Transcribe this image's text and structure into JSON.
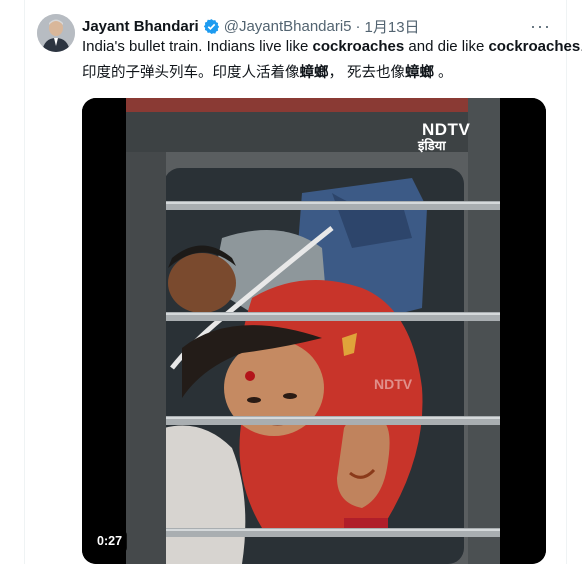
{
  "tweet": {
    "author_name": "Jayant Bhandari",
    "handle": "@JayantBhandari5",
    "separator": "·",
    "date": "1月13日",
    "more_label": "···",
    "text_en": {
      "part1": "India's bullet train. Indians live like ",
      "bold1": "cockroaches",
      "part2": " and die like ",
      "bold2": "cockroaches",
      "part3": "."
    },
    "text_zh": {
      "part1": "印度的子弹头列车。印度人活着像",
      "bold1": "蟑螂",
      "part2": "，  死去也像",
      "bold2": "蟑螂",
      "part3": " 。"
    }
  },
  "video": {
    "duration": "0:27",
    "watermark_top": "NDTV",
    "watermark_bottom": "इंडिया"
  },
  "colors": {
    "verified_blue": "#1d9bf0",
    "muted_text": "#536471",
    "sari_red": "#c8342a"
  }
}
